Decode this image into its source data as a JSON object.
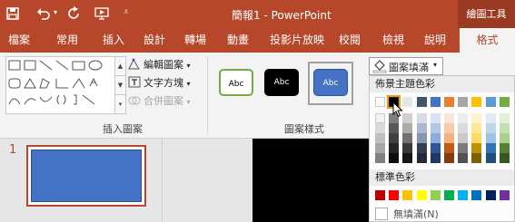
{
  "app": {
    "title": "簡報1 - PowerPoint",
    "contextual_tab_group": "繪圖工具"
  },
  "quick_access": [
    "save-icon",
    "undo-icon",
    "redo-icon",
    "from-beginning-icon",
    "customize-icon"
  ],
  "tabs": [
    {
      "label": "檔案",
      "active": false
    },
    {
      "label": "常用",
      "active": false
    },
    {
      "label": "插入",
      "active": false
    },
    {
      "label": "設計",
      "active": false
    },
    {
      "label": "轉場",
      "active": false
    },
    {
      "label": "動畫",
      "active": false
    },
    {
      "label": "投影片放映",
      "active": false
    },
    {
      "label": "校閱",
      "active": false
    },
    {
      "label": "檢視",
      "active": false
    },
    {
      "label": "說明",
      "active": false
    },
    {
      "label": "格式",
      "active": true
    }
  ],
  "ribbon": {
    "insert_shapes": {
      "label": "插入圖案",
      "edit_shape": "編輯圖案",
      "text_box": "文字方塊",
      "merge_shapes": "合併圖案"
    },
    "shape_styles": {
      "label": "圖案樣式",
      "thumbnails": [
        {
          "text": "Abc",
          "fill": "#ffffff",
          "border": "#70ad47",
          "text_color": "#000000"
        },
        {
          "text": "Abc",
          "fill": "#000000",
          "border": "#000000",
          "text_color": "#ffffff"
        },
        {
          "text": "Abc",
          "fill": "#4472c4",
          "border": "#2f528f",
          "text_color": "#ffffff",
          "selected": true
        }
      ]
    },
    "shape_fill": {
      "label": "圖案填滿"
    }
  },
  "fill_menu": {
    "theme_colors_label": "佈景主題色彩",
    "standard_colors_label": "標準色彩",
    "no_fill_label": "無填滿(N)",
    "theme_colors": [
      [
        "#ffffff",
        "#000000",
        "#e7e6e6",
        "#44546a",
        "#4472c4",
        "#ed7d31",
        "#a5a5a5",
        "#ffc000",
        "#5b9bd5",
        "#70ad47"
      ],
      [
        "#f2f2f2",
        "#7f7f7f",
        "#d0cece",
        "#d6dce4",
        "#dae3f3",
        "#fbe5d6",
        "#ededed",
        "#fff2cc",
        "#deebf7",
        "#e2f0d9"
      ],
      [
        "#d9d9d9",
        "#595959",
        "#aeabab",
        "#adb9ca",
        "#b4c7e7",
        "#f8cbad",
        "#dbdbdb",
        "#ffe699",
        "#bdd7ee",
        "#c5e0b4"
      ],
      [
        "#bfbfbf",
        "#404040",
        "#757171",
        "#8497b0",
        "#8faadc",
        "#f4b183",
        "#c9c9c9",
        "#ffd966",
        "#9dc3e6",
        "#a9d18e"
      ],
      [
        "#a6a6a6",
        "#262626",
        "#3a3838",
        "#333f50",
        "#2f5597",
        "#c55a11",
        "#7b7b7b",
        "#bf9000",
        "#2e75b6",
        "#548235"
      ],
      [
        "#808080",
        "#0d0d0d",
        "#171616",
        "#222a35",
        "#203864",
        "#843c0c",
        "#525252",
        "#7f6000",
        "#1f4e79",
        "#385723"
      ]
    ],
    "selected_theme_swatch": [
      0,
      1
    ],
    "standard_colors": [
      "#c00000",
      "#ff0000",
      "#ffc000",
      "#ffff00",
      "#92d050",
      "#00b050",
      "#00b0f0",
      "#0070c0",
      "#002060",
      "#7030a0"
    ]
  },
  "slides": {
    "current_number": "1"
  },
  "colors": {
    "accent": "#b7472a",
    "accent_dark": "#9b3a22"
  }
}
